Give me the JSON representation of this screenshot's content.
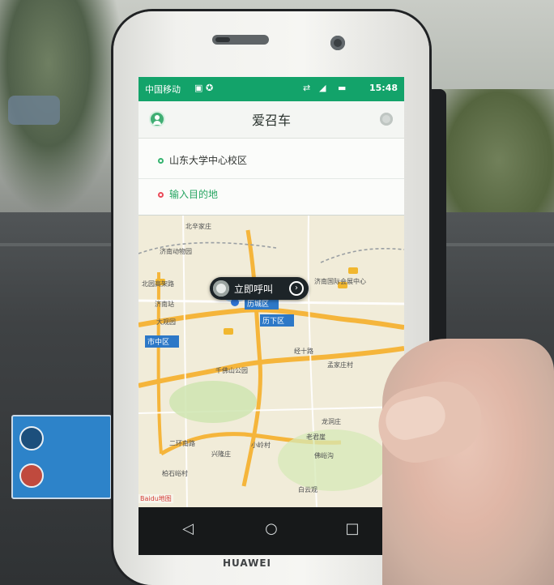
{
  "status": {
    "carrier": "中国移动",
    "time": "15:48"
  },
  "header": {
    "title": "爱召车"
  },
  "fields": {
    "origin": "山东大学中心校区",
    "destination": "输入目的地"
  },
  "map": {
    "call_button": "立即呼叫",
    "labels": [
      "北辛家庄",
      "济南动物园",
      "北园高架路",
      "济南站",
      "大观园",
      "市中区",
      "历下区",
      "历城区",
      "济南国际会展中心",
      "千佛山公园",
      "孟家庄村",
      "龙洞庄",
      "老君崖",
      "二环南路",
      "兴隆庄",
      "小岭村",
      "佛峪沟",
      "柏石峪村",
      "经十路",
      "白云观"
    ],
    "baidu_logo": "Baidu地图"
  },
  "device": {
    "brand": "HUAWEI"
  },
  "colors": {
    "status_green": "#13a36a",
    "map_bg": "#f1ecd9",
    "road_yellow": "#f5b53b",
    "blue_label": "#2d78c7",
    "taxi_yellow": "#f1b72f"
  },
  "icons": {
    "avatar": "person-icon",
    "call": "phone-icon",
    "back": "back-icon",
    "home": "home-icon",
    "recent": "recent-icon"
  }
}
